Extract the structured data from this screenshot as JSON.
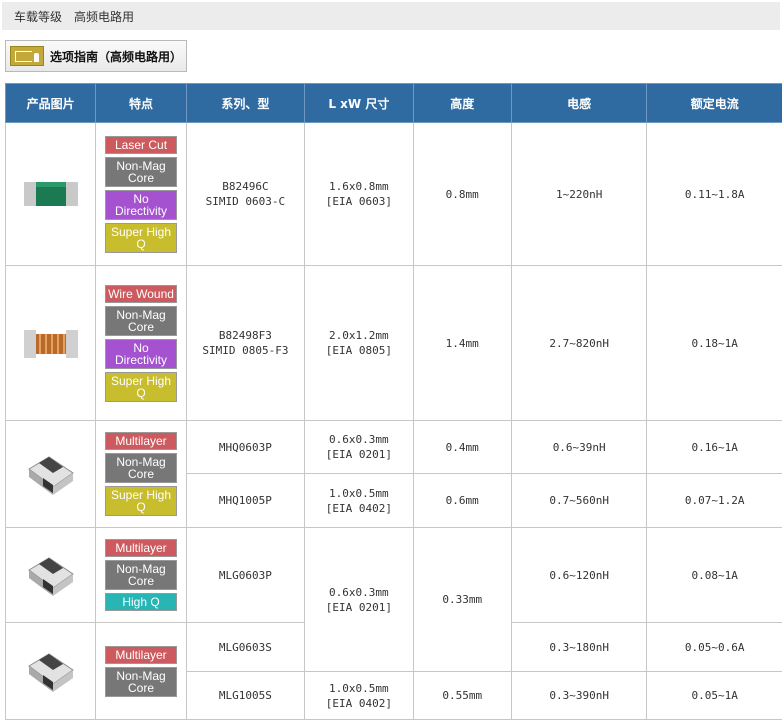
{
  "breadcrumb": [
    "车载等级",
    "高频电路用"
  ],
  "guide": {
    "label": "选项指南（高频电路用）"
  },
  "headers": [
    "产品图片",
    "特点",
    "系列、型",
    "L xW 尺寸",
    "高度",
    "电感",
    "额定电流"
  ],
  "tags": {
    "laser_cut": "Laser Cut",
    "non_mag_core": "Non-Mag Core",
    "no_directivity": "No Directivity",
    "super_high_q": "Super High Q",
    "wire_wound": "Wire Wound",
    "multilayer": "Multilayer",
    "high_q": "High Q"
  },
  "rows": [
    {
      "series": [
        "B82496C",
        "SIMID 0603-C"
      ],
      "size": [
        "1.6x0.8mm",
        "[EIA 0603]"
      ],
      "height": "0.8mm",
      "inductance": "1~220nH",
      "current": "0.11~1.8A"
    },
    {
      "series": [
        "B82498F3",
        "SIMID 0805-F3"
      ],
      "size": [
        "2.0x1.2mm",
        "[EIA 0805]"
      ],
      "height": "1.4mm",
      "inductance": "2.7~820nH",
      "current": "0.18~1A"
    },
    {
      "series": [
        "MHQ0603P"
      ],
      "size": [
        "0.6x0.3mm",
        "[EIA 0201]"
      ],
      "height": "0.4mm",
      "inductance": "0.6~39nH",
      "current": "0.16~1A"
    },
    {
      "series": [
        "MHQ1005P"
      ],
      "size": [
        "1.0x0.5mm",
        "[EIA 0402]"
      ],
      "height": "0.6mm",
      "inductance": "0.7~560nH",
      "current": "0.07~1.2A"
    },
    {
      "series": [
        "MLG0603P"
      ],
      "size": [
        "0.6x0.3mm",
        "[EIA 0201]"
      ],
      "height": "0.33mm",
      "inductance": "0.6~120nH",
      "current": "0.08~1A"
    },
    {
      "series": [
        "MLG0603S"
      ],
      "inductance": "0.3~180nH",
      "current": "0.05~0.6A"
    },
    {
      "series": [
        "MLG1005S"
      ],
      "size": [
        "1.0x0.5mm",
        "[EIA 0402]"
      ],
      "height": "0.55mm",
      "inductance": "0.3~390nH",
      "current": "0.05~1A"
    }
  ]
}
